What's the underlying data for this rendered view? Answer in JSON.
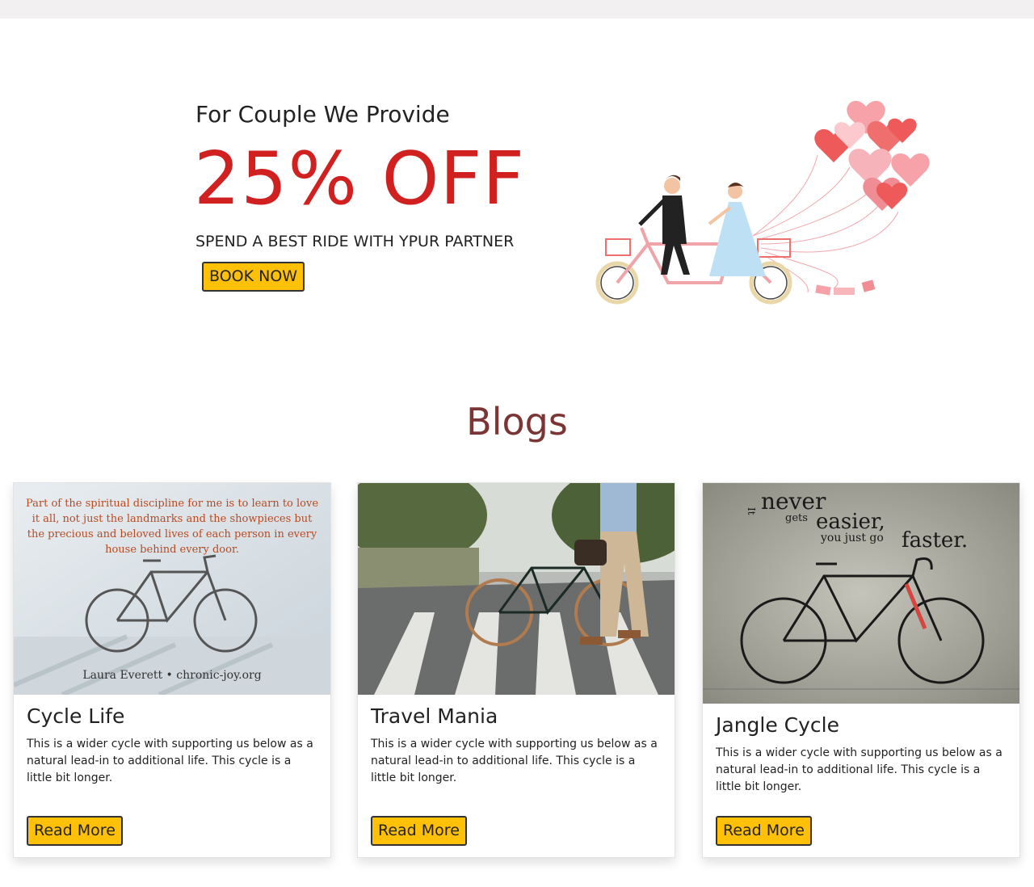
{
  "promo": {
    "subtitle": "For Couple We Provide",
    "discount": "25% OFF",
    "tagline": "SPEND A BEST RIDE WITH YPUR PARTNER",
    "button_label": "BOOK NOW"
  },
  "blogs": {
    "title": "Blogs",
    "cards": [
      {
        "title": "Cycle Life",
        "text": "This is a wider cycle with supporting us below as a natural lead-in to additional life. This cycle is a little bit longer.",
        "button_label": "Read More",
        "image_quote": "Part of the spiritual discipline for me is to learn to love it all, not just the landmarks and the showpieces but the precious and beloved lives of each person in every house behind every door.",
        "image_credit": "Laura Everett • chronic-joy.org"
      },
      {
        "title": "Travel Mania",
        "text": "This is a wider cycle with supporting us below as a natural lead-in to additional life. This cycle is a little bit longer.",
        "button_label": "Read More"
      },
      {
        "title": "Jangle Cycle",
        "text": "This is a wider cycle with supporting us below as a natural lead-in to additional life. This cycle is a little bit longer.",
        "button_label": "Read More",
        "image_quote_1": "never",
        "image_quote_prefix": "It",
        "image_quote_2": "gets",
        "image_quote_3": "easier,",
        "image_quote_4": "you just go",
        "image_quote_5": "faster."
      }
    ]
  },
  "colors": {
    "accent_yellow": "#ffc107",
    "discount_red": "#d02020",
    "blogs_title": "#7b3535"
  }
}
